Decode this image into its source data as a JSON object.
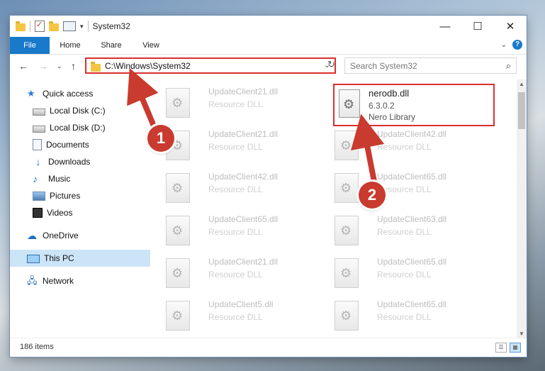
{
  "window": {
    "title": "System32"
  },
  "ribbon": {
    "tabs": [
      "File",
      "Home",
      "Share",
      "View"
    ]
  },
  "nav": {
    "address": "C:\\Windows\\System32",
    "search_placeholder": "Search System32"
  },
  "sidebar": {
    "items": [
      {
        "label": "Quick access",
        "icon": "star-icon",
        "pinned": false
      },
      {
        "label": "Local Disk (C:)",
        "icon": "drive-icon",
        "pinned": true
      },
      {
        "label": "Local Disk (D:)",
        "icon": "drive-icon",
        "pinned": true
      },
      {
        "label": "Documents",
        "icon": "document-icon",
        "pinned": true
      },
      {
        "label": "Downloads",
        "icon": "download-icon",
        "pinned": true
      },
      {
        "label": "Music",
        "icon": "music-icon",
        "pinned": true
      },
      {
        "label": "Pictures",
        "icon": "pictures-icon",
        "pinned": true
      },
      {
        "label": "Videos",
        "icon": "videos-icon",
        "pinned": true
      },
      {
        "label": "OneDrive",
        "icon": "cloud-icon",
        "pinned": false
      },
      {
        "label": "This PC",
        "icon": "computer-icon",
        "pinned": false,
        "selected": true
      },
      {
        "label": "Network",
        "icon": "network-icon",
        "pinned": false
      }
    ]
  },
  "files": {
    "left_column": [
      {
        "name": "UpdateClient21.dll",
        "type": "Resource DLL"
      },
      {
        "name": "UpdateClient21.dll",
        "type": "Resource DLL"
      },
      {
        "name": "UpdateClient42.dll",
        "type": "Resource DLL"
      },
      {
        "name": "UpdateClient65.dll",
        "type": "Resource DLL"
      },
      {
        "name": "UpdateClient21.dll",
        "type": "Resource DLL"
      },
      {
        "name": "UpdateClient5.dll",
        "type": "Resource DLL"
      }
    ],
    "right_column": [
      {
        "name": "nerodb.dll",
        "version": "6.3.0.2",
        "description": "Nero Library",
        "highlighted": true
      },
      {
        "name": "UpdateClient42.dll",
        "type": "Resource DLL"
      },
      {
        "name": "UpdateClient65.dll",
        "type": "Resource DLL"
      },
      {
        "name": "UpdateClient63.dll",
        "type": "Resource DLL"
      },
      {
        "name": "UpdateClient65.dll",
        "type": "Resource DLL"
      },
      {
        "name": "UpdateClient65.dll",
        "type": "Resource DLL"
      }
    ]
  },
  "status": {
    "item_count": "186 items"
  },
  "annotations": {
    "step1": "1",
    "step2": "2",
    "color": "#c93a2f"
  }
}
